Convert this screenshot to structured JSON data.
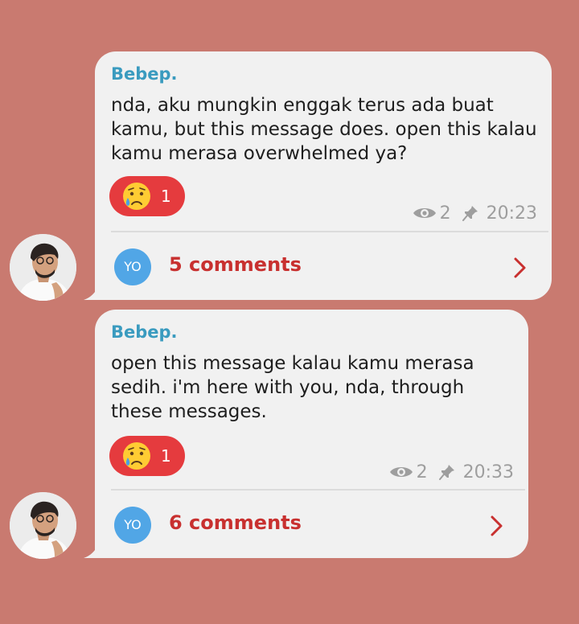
{
  "colors": {
    "background": "#c97a70",
    "bubble": "#f1f1f1",
    "author": "#3a9bbf",
    "reaction": "#e53b3e",
    "comments": "#c8302f",
    "commenter_avatar": "#51a6e6",
    "meta": "#9e9e9e"
  },
  "posts": [
    {
      "author": "Bebep.",
      "text": "nda, aku mungkin enggak terus ada buat kamu, but this message does. open this kalau kamu merasa overwhelmed ya?",
      "reaction": {
        "emoji": "crying-face-icon",
        "count": "1"
      },
      "views": "2",
      "time": "20:23",
      "commenter_initials": "YO",
      "comments_label": "5 comments"
    },
    {
      "author": "Bebep.",
      "text": "open this message kalau kamu merasa sedih. i'm here with you, nda, through these messages.",
      "reaction": {
        "emoji": "crying-face-icon",
        "count": "1"
      },
      "views": "2",
      "time": "20:33",
      "commenter_initials": "YO",
      "comments_label": "6 comments"
    }
  ]
}
